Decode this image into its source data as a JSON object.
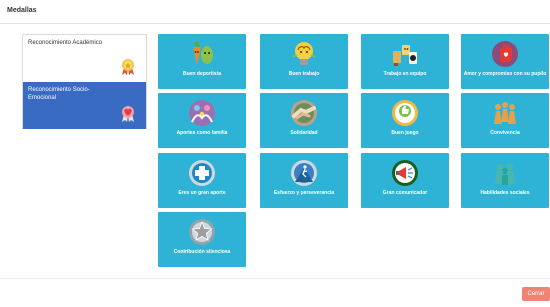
{
  "modal": {
    "title": "Medallas"
  },
  "categories": [
    {
      "label": "Reconocimiento Académico",
      "icon": "ribbon-medal-icon",
      "selected": false
    },
    {
      "label": "Reconocimiento Socio-Emocional",
      "icon": "heart-medal-icon",
      "selected": true
    }
  ],
  "medals": [
    {
      "title": "Buen deportista",
      "icon": "veggie-characters-icon"
    },
    {
      "title": "Buen trabajo",
      "icon": "lightbulb-brain-icon"
    },
    {
      "title": "Trabajo en equipo",
      "icon": "team-characters-icon"
    },
    {
      "title": "Amor y compromiso con su pupilo",
      "icon": "hand-heart-icon"
    },
    {
      "title": "Aportes como familia",
      "icon": "family-icon"
    },
    {
      "title": "Solidaridad",
      "icon": "handshake-icon"
    },
    {
      "title": "Buen juego",
      "icon": "thumbs-up-icon"
    },
    {
      "title": "Convivencia",
      "icon": "people-group-icon"
    },
    {
      "title": "Eres un gran aporte",
      "icon": "plus-icon"
    },
    {
      "title": "Esfuerzo y perseverancia",
      "icon": "climbing-person-icon"
    },
    {
      "title": "Gran comunicador",
      "icon": "megaphone-icon"
    },
    {
      "title": "Habilidades sociales",
      "icon": "social-people-icon"
    },
    {
      "title": "Contribución silenciosa",
      "icon": "star-icon"
    }
  ],
  "footer": {
    "close_label": "Cerrar"
  },
  "colors": {
    "card_bg": "#2eb3d7",
    "selected_category": "#3a6bc3",
    "close_button": "#f08373"
  }
}
